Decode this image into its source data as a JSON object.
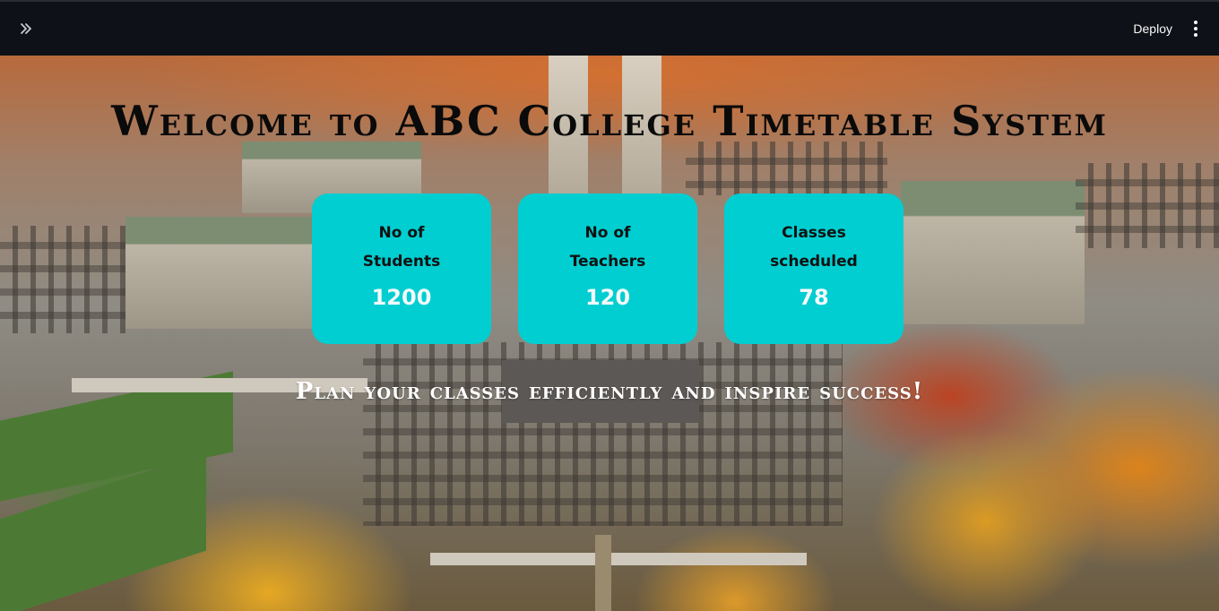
{
  "topbar": {
    "expand_icon": "double-chevron-right-icon",
    "deploy_label": "Deploy",
    "menu_icon": "vertical-ellipsis-icon"
  },
  "hero": {
    "title": "Welcome to ABC College Timetable System",
    "tagline": "Plan your classes efficiently and inspire success!"
  },
  "cards": [
    {
      "label": "No of Students",
      "value": "1200"
    },
    {
      "label": "No of Teachers",
      "value": "120"
    },
    {
      "label": "Classes scheduled",
      "value": "78"
    }
  ],
  "colors": {
    "topbar_bg": "#0e1117",
    "card_bg": "#00ced1",
    "card_value": "#f5f9fb",
    "title": "#0a0a0a",
    "tagline": "#ffffff"
  }
}
